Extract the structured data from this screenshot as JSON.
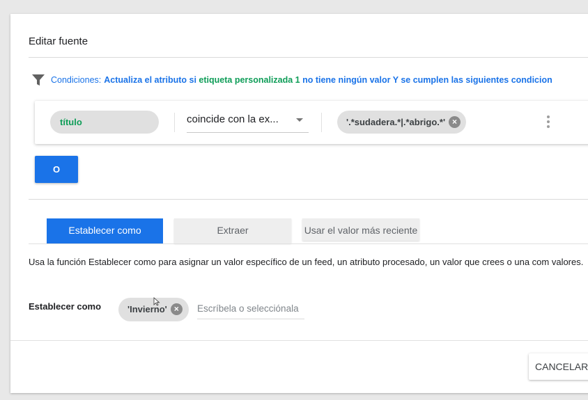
{
  "dialog": {
    "title": "Editar fuente"
  },
  "conditions": {
    "icon": "filter-icon",
    "prefix": "Condiciones:",
    "text_part1": "Actualiza el atributo si",
    "text_attr": "etiqueta personalizada 1",
    "text_part2": "no tiene ningún valor Y se cumplen las siguientes condicion",
    "rule": {
      "attribute": "título",
      "operator": "coincide con la ex...",
      "value": "'.*sudadera.*|.*abrigo.*'"
    },
    "or_button": "O"
  },
  "tabs": [
    {
      "label": "Establecer como",
      "active": true
    },
    {
      "label": "Extraer",
      "active": false
    },
    {
      "label": "Usar el valor más reciente",
      "active": false
    }
  ],
  "description": "Usa la función Establecer como para asignar un valor específico de un feed, un atributo procesado, un valor que crees o una com valores.",
  "set_as": {
    "label": "Establecer como",
    "chip_value": "'Invierno'",
    "placeholder": "Escríbela o selecciónala"
  },
  "footer": {
    "cancel_label": "CANCELAR"
  },
  "colors": {
    "accent": "#1a73e8",
    "attribute_green": "#0f9d58"
  }
}
